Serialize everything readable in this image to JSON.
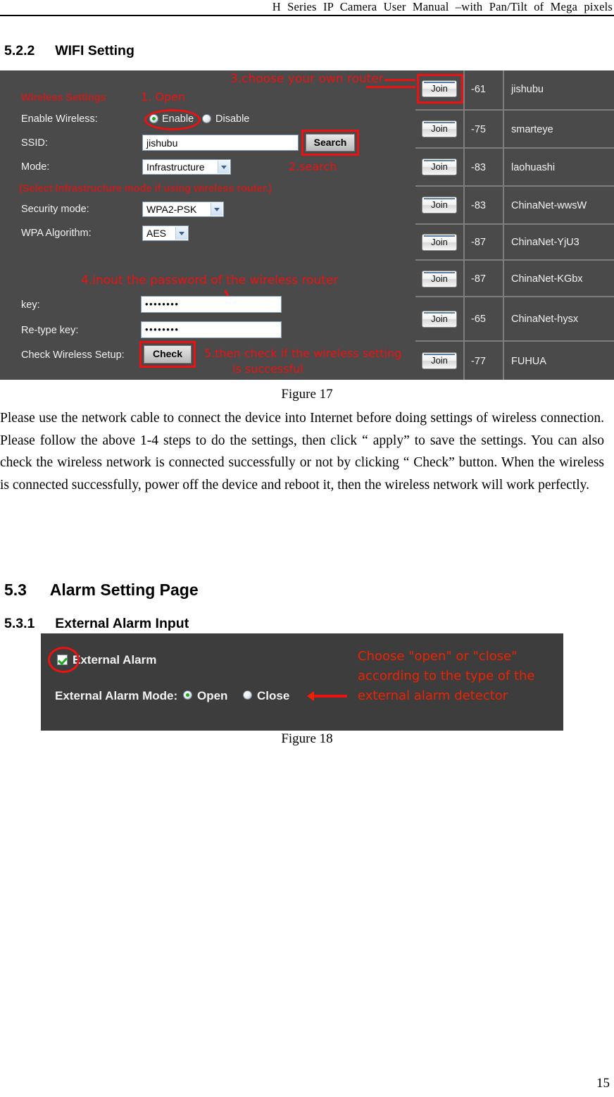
{
  "header": {
    "running_title": "H Series IP Camera User Manual –with Pan/Tilt of Mega pixels"
  },
  "sections": {
    "wifi": {
      "number": "5.2.2",
      "title": "WIFI Setting"
    },
    "alarm_page": {
      "number": "5.3",
      "title": "Alarm Setting Page"
    },
    "external_alarm": {
      "number": "5.3.1",
      "title": "External Alarm Input"
    }
  },
  "wifi_panel": {
    "group_title": "Wireless Settings",
    "labels": {
      "enable_wireless": "Enable Wireless:",
      "ssid": "SSID:",
      "mode": "Mode:",
      "security_mode": "Security mode:",
      "wpa_algorithm": "WPA Algorithm:",
      "key": "key:",
      "retype_key": "Re-type key:",
      "check_wireless_setup": "Check  Wireless Setup:"
    },
    "note": "(Select Infrastructure mode if using wireless router.)",
    "radio_enable": "Enable",
    "radio_disable": "Disable",
    "ssid_value": "jishubu",
    "search_button": "Search",
    "mode_value": "Infrastructure",
    "security_value": "WPA2-PSK",
    "wpa_value": "AES",
    "key_value": "••••••••",
    "retype_value": "••••••••",
    "check_button": "Check",
    "annotations": {
      "step1": "1. Open",
      "step2": "2.search",
      "step3": "3.choose your own router",
      "step4": "4.inout the password of the wireless router",
      "step5_line1": "5.then check if the wireless setting",
      "step5_line2": "is successful"
    }
  },
  "network_list": {
    "join_label": "Join",
    "rows": [
      {
        "signal": "-61",
        "ssid": "jishubu"
      },
      {
        "signal": "-75",
        "ssid": "smarteye"
      },
      {
        "signal": "-83",
        "ssid": "laohuashi"
      },
      {
        "signal": "-83",
        "ssid": "ChinaNet-wwsW"
      },
      {
        "signal": "-87",
        "ssid": "ChinaNet-YjU3"
      },
      {
        "signal": "-87",
        "ssid": "ChinaNet-KGbx"
      },
      {
        "signal": "-65",
        "ssid": "ChinaNet-hysx"
      },
      {
        "signal": "-77",
        "ssid": "FUHUA"
      }
    ]
  },
  "figures": {
    "fig17": "Figure 17",
    "fig18": "Figure 18"
  },
  "body_paragraph": "Please use the network cable to connect the device into Internet before doing settings of wireless connection. Please follow the above 1-4 steps to do the settings, then click “ apply”  to save the settings. You can also check the wireless network is connected successfully or not by clicking “ Check”  button. When the wireless is connected successfully, power off the device and reboot it, then the wireless network will work perfectly.",
  "alarm_panel": {
    "external_alarm_label": "External Alarm",
    "mode_label": "External Alarm Mode:",
    "option_open": "Open",
    "option_close": "Close",
    "annotation_line1": "Choose \"open\" or \"close\"",
    "annotation_line2": "according to the type of the",
    "annotation_line3": "external alarm detector"
  },
  "footer": {
    "page_number": "15"
  },
  "colors": {
    "annotation_red": "#ee1111",
    "panel_bg": "#4a4a4a",
    "alarm_panel_bg": "#3d3d3d"
  }
}
